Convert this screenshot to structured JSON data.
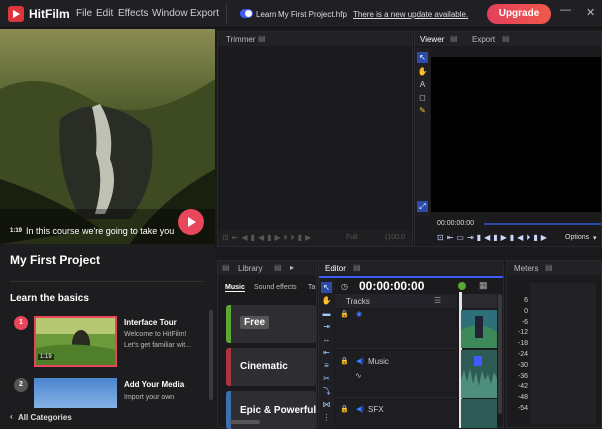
{
  "app": {
    "title": "HitFilm"
  },
  "menu": {
    "items": [
      "File",
      "Edit",
      "Effects",
      "Window",
      "Export"
    ]
  },
  "learn_toggle_label": "Learn",
  "project_file": "My First Project.hfp",
  "update_link": "There is a new update available.",
  "upgrade_button": "Upgrade",
  "window_controls": {
    "minimize": "—",
    "close": "✕"
  },
  "video": {
    "caption": "In this course we're going to take you",
    "timestamp": "1:19"
  },
  "project": {
    "title": "My First Project"
  },
  "learn": {
    "heading": "Learn the basics",
    "tutorials": [
      {
        "num": "1",
        "title": "Interface Tour",
        "desc1": "Welcome to HitFilm!",
        "desc2": "Let's get familiar wit...",
        "duration": "1:19"
      },
      {
        "num": "2",
        "title": "Add Your Media",
        "desc1": "Import your own",
        "desc2": ""
      }
    ],
    "all_categories": "All Categories"
  },
  "trimmer": {
    "tab": "Trimmer",
    "zoom": "Full",
    "percent": "(100.0"
  },
  "viewer": {
    "tab": "Viewer",
    "export_tab": "Export",
    "timecode": "00:00:00:00",
    "options": "Options"
  },
  "library": {
    "tab": "Library",
    "tab_arrow": "▸",
    "subtabs": [
      "Music",
      "Sound effects",
      "Ta"
    ],
    "items": [
      {
        "label": "Free",
        "badge": true,
        "color": "#5aa833"
      },
      {
        "label": "Cinematic",
        "badge": false,
        "color": "#a8353d"
      },
      {
        "label": "Epic & Powerful",
        "badge": false,
        "color": "#3a6fb0"
      }
    ]
  },
  "editor": {
    "tab": "Editor",
    "timecode": "00:00:00:00",
    "tracks_label": "Tracks",
    "tracks": [
      {
        "name": "Music"
      },
      {
        "name": "SFX"
      }
    ]
  },
  "meters": {
    "tab": "Meters",
    "labels": [
      "6",
      "0",
      "-6",
      "-12",
      "-18",
      "-24",
      "-30",
      "-36",
      "-42",
      "-48",
      "-54"
    ]
  },
  "colors": {
    "accent": "#3d5bff",
    "brand": "#d9363e",
    "upgrade": "#e8465a"
  }
}
